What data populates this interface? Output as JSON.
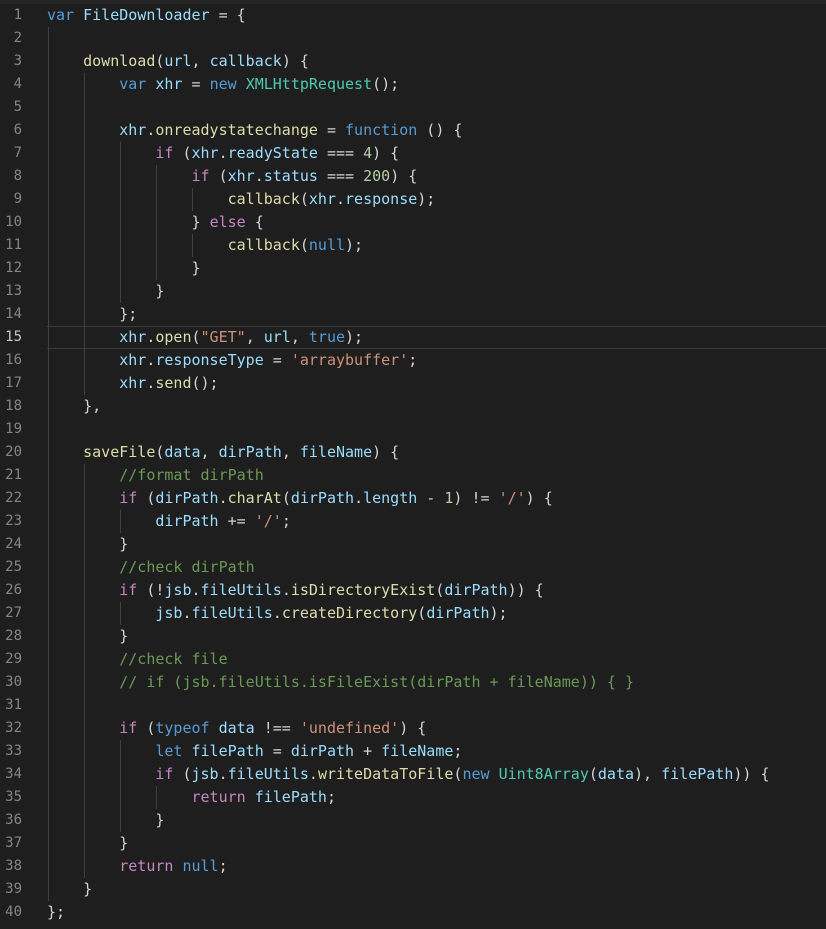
{
  "editor": {
    "current_line": 15,
    "lines": [
      {
        "n": "1",
        "indent": 0,
        "t": [
          [
            "kw",
            "var"
          ],
          [
            "p",
            " "
          ],
          [
            "var",
            "FileDownloader"
          ],
          [
            "p",
            " = {"
          ]
        ]
      },
      {
        "n": "2",
        "indent": 0,
        "t": []
      },
      {
        "n": "3",
        "indent": 1,
        "t": [
          [
            "fn",
            "download"
          ],
          [
            "p",
            "("
          ],
          [
            "var",
            "url"
          ],
          [
            "p",
            ", "
          ],
          [
            "var",
            "callback"
          ],
          [
            "p",
            ") {"
          ]
        ]
      },
      {
        "n": "4",
        "indent": 2,
        "t": [
          [
            "kw",
            "var"
          ],
          [
            "p",
            " "
          ],
          [
            "var",
            "xhr"
          ],
          [
            "p",
            " = "
          ],
          [
            "kw",
            "new"
          ],
          [
            "p",
            " "
          ],
          [
            "cls",
            "XMLHttpRequest"
          ],
          [
            "p",
            "();"
          ]
        ]
      },
      {
        "n": "5",
        "indent": 0,
        "t": []
      },
      {
        "n": "6",
        "indent": 2,
        "t": [
          [
            "var",
            "xhr"
          ],
          [
            "p",
            "."
          ],
          [
            "fn",
            "onreadystatechange"
          ],
          [
            "p",
            " = "
          ],
          [
            "kw",
            "function"
          ],
          [
            "p",
            " () {"
          ]
        ]
      },
      {
        "n": "7",
        "indent": 3,
        "t": [
          [
            "ctl",
            "if"
          ],
          [
            "p",
            " ("
          ],
          [
            "var",
            "xhr"
          ],
          [
            "p",
            "."
          ],
          [
            "var",
            "readyState"
          ],
          [
            "p",
            " === "
          ],
          [
            "num",
            "4"
          ],
          [
            "p",
            ") {"
          ]
        ]
      },
      {
        "n": "8",
        "indent": 4,
        "t": [
          [
            "ctl",
            "if"
          ],
          [
            "p",
            " ("
          ],
          [
            "var",
            "xhr"
          ],
          [
            "p",
            "."
          ],
          [
            "var",
            "status"
          ],
          [
            "p",
            " === "
          ],
          [
            "num",
            "200"
          ],
          [
            "p",
            ") {"
          ]
        ]
      },
      {
        "n": "9",
        "indent": 5,
        "t": [
          [
            "fn",
            "callback"
          ],
          [
            "p",
            "("
          ],
          [
            "var",
            "xhr"
          ],
          [
            "p",
            "."
          ],
          [
            "var",
            "response"
          ],
          [
            "p",
            ");"
          ]
        ]
      },
      {
        "n": "10",
        "indent": 4,
        "t": [
          [
            "p",
            "} "
          ],
          [
            "ctl",
            "else"
          ],
          [
            "p",
            " {"
          ]
        ]
      },
      {
        "n": "11",
        "indent": 5,
        "t": [
          [
            "fn",
            "callback"
          ],
          [
            "p",
            "("
          ],
          [
            "kw",
            "null"
          ],
          [
            "p",
            ");"
          ]
        ]
      },
      {
        "n": "12",
        "indent": 4,
        "t": [
          [
            "p",
            "}"
          ]
        ]
      },
      {
        "n": "13",
        "indent": 3,
        "t": [
          [
            "p",
            "}"
          ]
        ]
      },
      {
        "n": "14",
        "indent": 2,
        "t": [
          [
            "p",
            "};"
          ]
        ]
      },
      {
        "n": "15",
        "indent": 2,
        "t": [
          [
            "var",
            "xhr"
          ],
          [
            "p",
            "."
          ],
          [
            "fn",
            "open"
          ],
          [
            "p",
            "("
          ],
          [
            "str",
            "\"GET\""
          ],
          [
            "p",
            ", "
          ],
          [
            "var",
            "url"
          ],
          [
            "p",
            ", "
          ],
          [
            "kw",
            "true"
          ],
          [
            "p",
            ");"
          ]
        ]
      },
      {
        "n": "16",
        "indent": 2,
        "t": [
          [
            "var",
            "xhr"
          ],
          [
            "p",
            "."
          ],
          [
            "var",
            "responseType"
          ],
          [
            "p",
            " = "
          ],
          [
            "str",
            "'arraybuffer'"
          ],
          [
            "p",
            ";"
          ]
        ]
      },
      {
        "n": "17",
        "indent": 2,
        "t": [
          [
            "var",
            "xhr"
          ],
          [
            "p",
            "."
          ],
          [
            "fn",
            "send"
          ],
          [
            "p",
            "();"
          ]
        ]
      },
      {
        "n": "18",
        "indent": 1,
        "t": [
          [
            "p",
            "},"
          ]
        ]
      },
      {
        "n": "19",
        "indent": 0,
        "t": []
      },
      {
        "n": "20",
        "indent": 1,
        "t": [
          [
            "fn",
            "saveFile"
          ],
          [
            "p",
            "("
          ],
          [
            "var",
            "data"
          ],
          [
            "p",
            ", "
          ],
          [
            "var",
            "dirPath"
          ],
          [
            "p",
            ", "
          ],
          [
            "var",
            "fileName"
          ],
          [
            "p",
            ") {"
          ]
        ]
      },
      {
        "n": "21",
        "indent": 2,
        "t": [
          [
            "cmt",
            "//format dirPath"
          ]
        ]
      },
      {
        "n": "22",
        "indent": 2,
        "t": [
          [
            "ctl",
            "if"
          ],
          [
            "p",
            " ("
          ],
          [
            "var",
            "dirPath"
          ],
          [
            "p",
            "."
          ],
          [
            "fn",
            "charAt"
          ],
          [
            "p",
            "("
          ],
          [
            "var",
            "dirPath"
          ],
          [
            "p",
            "."
          ],
          [
            "var",
            "length"
          ],
          [
            "p",
            " - "
          ],
          [
            "num",
            "1"
          ],
          [
            "p",
            ") != "
          ],
          [
            "str",
            "'/'"
          ],
          [
            "p",
            ") {"
          ]
        ]
      },
      {
        "n": "23",
        "indent": 3,
        "t": [
          [
            "var",
            "dirPath"
          ],
          [
            "p",
            " += "
          ],
          [
            "str",
            "'/'"
          ],
          [
            "p",
            ";"
          ]
        ]
      },
      {
        "n": "24",
        "indent": 2,
        "t": [
          [
            "p",
            "}"
          ]
        ]
      },
      {
        "n": "25",
        "indent": 2,
        "t": [
          [
            "cmt",
            "//check dirPath"
          ]
        ]
      },
      {
        "n": "26",
        "indent": 2,
        "t": [
          [
            "ctl",
            "if"
          ],
          [
            "p",
            " (!"
          ],
          [
            "var",
            "jsb"
          ],
          [
            "p",
            "."
          ],
          [
            "var",
            "fileUtils"
          ],
          [
            "p",
            "."
          ],
          [
            "fn",
            "isDirectoryExist"
          ],
          [
            "p",
            "("
          ],
          [
            "var",
            "dirPath"
          ],
          [
            "p",
            ")) {"
          ]
        ]
      },
      {
        "n": "27",
        "indent": 3,
        "t": [
          [
            "var",
            "jsb"
          ],
          [
            "p",
            "."
          ],
          [
            "var",
            "fileUtils"
          ],
          [
            "p",
            "."
          ],
          [
            "fn",
            "createDirectory"
          ],
          [
            "p",
            "("
          ],
          [
            "var",
            "dirPath"
          ],
          [
            "p",
            ");"
          ]
        ]
      },
      {
        "n": "28",
        "indent": 2,
        "t": [
          [
            "p",
            "}"
          ]
        ]
      },
      {
        "n": "29",
        "indent": 2,
        "t": [
          [
            "cmt",
            "//check file"
          ]
        ]
      },
      {
        "n": "30",
        "indent": 2,
        "t": [
          [
            "cmt",
            "// if (jsb.fileUtils.isFileExist(dirPath + fileName)) { }"
          ]
        ]
      },
      {
        "n": "31",
        "indent": 0,
        "t": []
      },
      {
        "n": "32",
        "indent": 2,
        "t": [
          [
            "ctl",
            "if"
          ],
          [
            "p",
            " ("
          ],
          [
            "kw",
            "typeof"
          ],
          [
            "p",
            " "
          ],
          [
            "var",
            "data"
          ],
          [
            "p",
            " !== "
          ],
          [
            "str",
            "'undefined'"
          ],
          [
            "p",
            ") {"
          ]
        ]
      },
      {
        "n": "33",
        "indent": 3,
        "t": [
          [
            "kw",
            "let"
          ],
          [
            "p",
            " "
          ],
          [
            "var",
            "filePath"
          ],
          [
            "p",
            " = "
          ],
          [
            "var",
            "dirPath"
          ],
          [
            "p",
            " + "
          ],
          [
            "var",
            "fileName"
          ],
          [
            "p",
            ";"
          ]
        ]
      },
      {
        "n": "34",
        "indent": 3,
        "t": [
          [
            "ctl",
            "if"
          ],
          [
            "p",
            " ("
          ],
          [
            "var",
            "jsb"
          ],
          [
            "p",
            "."
          ],
          [
            "var",
            "fileUtils"
          ],
          [
            "p",
            "."
          ],
          [
            "fn",
            "writeDataToFile"
          ],
          [
            "p",
            "("
          ],
          [
            "kw",
            "new"
          ],
          [
            "p",
            " "
          ],
          [
            "cls",
            "Uint8Array"
          ],
          [
            "p",
            "("
          ],
          [
            "var",
            "data"
          ],
          [
            "p",
            "), "
          ],
          [
            "var",
            "filePath"
          ],
          [
            "p",
            ")) {"
          ]
        ]
      },
      {
        "n": "35",
        "indent": 4,
        "t": [
          [
            "ctl",
            "return"
          ],
          [
            "p",
            " "
          ],
          [
            "var",
            "filePath"
          ],
          [
            "p",
            ";"
          ]
        ]
      },
      {
        "n": "36",
        "indent": 3,
        "t": [
          [
            "p",
            "}"
          ]
        ]
      },
      {
        "n": "37",
        "indent": 2,
        "t": [
          [
            "p",
            "}"
          ]
        ]
      },
      {
        "n": "38",
        "indent": 2,
        "t": [
          [
            "ctl",
            "return"
          ],
          [
            "p",
            " "
          ],
          [
            "kw",
            "null"
          ],
          [
            "p",
            ";"
          ]
        ]
      },
      {
        "n": "39",
        "indent": 1,
        "t": [
          [
            "p",
            "}"
          ]
        ]
      },
      {
        "n": "40",
        "indent": 0,
        "t": [
          [
            "p",
            "};"
          ]
        ]
      }
    ],
    "guides": [
      [],
      [
        1
      ],
      [
        1
      ],
      [
        1,
        2
      ],
      [
        1,
        2
      ],
      [
        1,
        2
      ],
      [
        1,
        2,
        3
      ],
      [
        1,
        2,
        3,
        4
      ],
      [
        1,
        2,
        3,
        4,
        5
      ],
      [
        1,
        2,
        3,
        4
      ],
      [
        1,
        2,
        3,
        4,
        5
      ],
      [
        1,
        2,
        3,
        4
      ],
      [
        1,
        2,
        3
      ],
      [
        1,
        2
      ],
      [
        1,
        2
      ],
      [
        1,
        2
      ],
      [
        1,
        2
      ],
      [
        1
      ],
      [
        1
      ],
      [
        1
      ],
      [
        1,
        2
      ],
      [
        1,
        2
      ],
      [
        1,
        2,
        3
      ],
      [
        1,
        2
      ],
      [
        1,
        2
      ],
      [
        1,
        2
      ],
      [
        1,
        2,
        3
      ],
      [
        1,
        2
      ],
      [
        1,
        2
      ],
      [
        1,
        2
      ],
      [
        1,
        2
      ],
      [
        1,
        2
      ],
      [
        1,
        2,
        3
      ],
      [
        1,
        2,
        3
      ],
      [
        1,
        2,
        3,
        4
      ],
      [
        1,
        2,
        3
      ],
      [
        1,
        2
      ],
      [
        1,
        2
      ],
      [
        1
      ],
      []
    ]
  }
}
